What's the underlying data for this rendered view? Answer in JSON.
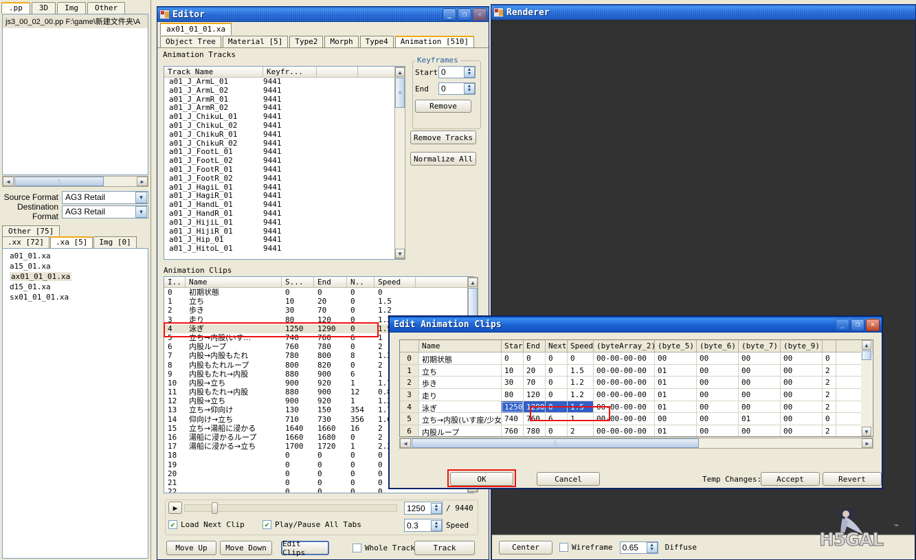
{
  "left_panel": {
    "tabs": [
      {
        "label": ".pp",
        "active": true
      },
      {
        "label": "3D",
        "active": false
      },
      {
        "label": "Img",
        "active": false
      },
      {
        "label": "Other",
        "active": false
      }
    ],
    "pp_entry": "js3_00_02_00.pp  F:\\game\\新建文件夹\\A",
    "source_format_label": "Source Format",
    "source_format_value": "AG3 Retail",
    "destination_format_label": "Destination Format",
    "destination_format_value": "AG3 Retail",
    "other_tab_label": "Other [75]",
    "sub_tabs": [
      {
        "label": ".xx [72]",
        "active": false
      },
      {
        "label": ".xa [5]",
        "active": true
      },
      {
        "label": "Img [0]",
        "active": false
      }
    ],
    "xa_files": [
      {
        "name": "a01_01.xa",
        "selected": false
      },
      {
        "name": "a15_01.xa",
        "selected": false
      },
      {
        "name": "ax01_01_01.xa",
        "selected": true
      },
      {
        "name": "d15_01.xa",
        "selected": false
      },
      {
        "name": "sx01_01_01.xa",
        "selected": false
      }
    ]
  },
  "editor": {
    "title": "Editor",
    "file_tab": "ax01_01_01.xa",
    "main_tabs": [
      {
        "label": "Object Tree",
        "active": false
      },
      {
        "label": "Material [5]",
        "active": false
      },
      {
        "label": "Type2",
        "active": false
      },
      {
        "label": "Morph",
        "active": false
      },
      {
        "label": "Type4",
        "active": false
      },
      {
        "label": "Animation [510]",
        "active": true
      }
    ],
    "tracks_section_label": "Animation Tracks",
    "tracks_headers": [
      "Track Name",
      "Keyfr..."
    ],
    "tracks": [
      {
        "name": "a01_J_ArmL_01",
        "keyframes": "9441"
      },
      {
        "name": "a01_J_ArmL_02",
        "keyframes": "9441"
      },
      {
        "name": "a01_J_ArmR_01",
        "keyframes": "9441"
      },
      {
        "name": "a01_J_ArmR_02",
        "keyframes": "9441"
      },
      {
        "name": "a01_J_ChikuL_01",
        "keyframes": "9441"
      },
      {
        "name": "a01_J_ChikuL_02",
        "keyframes": "9441"
      },
      {
        "name": "a01_J_ChikuR_01",
        "keyframes": "9441"
      },
      {
        "name": "a01_J_ChikuR_02",
        "keyframes": "9441"
      },
      {
        "name": "a01_J_FootL_01",
        "keyframes": "9441"
      },
      {
        "name": "a01_J_FootL_02",
        "keyframes": "9441"
      },
      {
        "name": "a01_J_FootR_01",
        "keyframes": "9441"
      },
      {
        "name": "a01_J_FootR_02",
        "keyframes": "9441"
      },
      {
        "name": "a01_J_HagiL_01",
        "keyframes": "9441"
      },
      {
        "name": "a01_J_HagiR_01",
        "keyframes": "9441"
      },
      {
        "name": "a01_J_HandL_01",
        "keyframes": "9441"
      },
      {
        "name": "a01_J_HandR_01",
        "keyframes": "9441"
      },
      {
        "name": "a01_J_HijiL_01",
        "keyframes": "9441"
      },
      {
        "name": "a01_J_HijiR_01",
        "keyframes": "9441"
      },
      {
        "name": "a01_J_Hip_01",
        "keyframes": "9441"
      },
      {
        "name": "a01_J_HitoL_01",
        "keyframes": "9441"
      }
    ],
    "keyframes_group": {
      "legend": "Keyframes",
      "start_label": "Start",
      "start_value": "0",
      "end_label": "End",
      "end_value": "0",
      "remove_label": "Remove"
    },
    "remove_tracks_label": "Remove Tracks",
    "normalize_all_label": "Normalize All",
    "clips_section_label": "Animation Clips",
    "clips_headers": [
      "I..",
      "Name",
      "S...",
      "End",
      "N..",
      "Speed"
    ],
    "clips": [
      {
        "i": "0",
        "name": "初期状態",
        "start": "0",
        "end": "0",
        "next": "0",
        "speed": "0"
      },
      {
        "i": "1",
        "name": "立ち",
        "start": "10",
        "end": "20",
        "next": "0",
        "speed": "1.5"
      },
      {
        "i": "2",
        "name": "歩き",
        "start": "30",
        "end": "70",
        "next": "0",
        "speed": "1.2"
      },
      {
        "i": "3",
        "name": "走り",
        "start": "80",
        "end": "120",
        "next": "0",
        "speed": "1.2"
      },
      {
        "i": "4",
        "name": "泳ぎ",
        "start": "1250",
        "end": "1290",
        "next": "0",
        "speed": "1.5"
      },
      {
        "i": "5",
        "name": "立ち→内股(いす...",
        "start": "740",
        "end": "760",
        "next": "6",
        "speed": "1"
      },
      {
        "i": "6",
        "name": "内股ループ",
        "start": "760",
        "end": "780",
        "next": "0",
        "speed": "2"
      },
      {
        "i": "7",
        "name": "内股→内股もたれ",
        "start": "780",
        "end": "800",
        "next": "8",
        "speed": "1.2"
      },
      {
        "i": "8",
        "name": "内股もたれループ",
        "start": "800",
        "end": "820",
        "next": "0",
        "speed": "2"
      },
      {
        "i": "9",
        "name": "内股もたれ→内股",
        "start": "880",
        "end": "900",
        "next": "6",
        "speed": "1"
      },
      {
        "i": "10",
        "name": "内股→立ち",
        "start": "900",
        "end": "920",
        "next": "1",
        "speed": "1.7"
      },
      {
        "i": "11",
        "name": "内股もたれ→内股",
        "start": "880",
        "end": "900",
        "next": "12",
        "speed": "0.8"
      },
      {
        "i": "12",
        "name": "内股→立ち",
        "start": "900",
        "end": "920",
        "next": "1",
        "speed": "1.2"
      },
      {
        "i": "13",
        "name": "立ち→仰向け",
        "start": "130",
        "end": "150",
        "next": "354",
        "speed": "1.7"
      },
      {
        "i": "14",
        "name": "仰向け→立ち",
        "start": "710",
        "end": "730",
        "next": "356",
        "speed": "1.6"
      },
      {
        "i": "15",
        "name": "立ち→湯船に浸かる",
        "start": "1640",
        "end": "1660",
        "next": "16",
        "speed": "2"
      },
      {
        "i": "16",
        "name": "湯船に浸かるループ",
        "start": "1660",
        "end": "1680",
        "next": "0",
        "speed": "2"
      },
      {
        "i": "17",
        "name": "湯船に浸かる→立ち",
        "start": "1700",
        "end": "1720",
        "next": "1",
        "speed": "2.2"
      },
      {
        "i": "18",
        "name": "",
        "start": "0",
        "end": "0",
        "next": "0",
        "speed": "0"
      },
      {
        "i": "19",
        "name": "",
        "start": "0",
        "end": "0",
        "next": "0",
        "speed": "0"
      },
      {
        "i": "20",
        "name": "",
        "start": "0",
        "end": "0",
        "next": "0",
        "speed": "0"
      },
      {
        "i": "21",
        "name": "",
        "start": "0",
        "end": "0",
        "next": "0",
        "speed": "0"
      },
      {
        "i": "22",
        "name": "",
        "start": "0",
        "end": "0",
        "next": "0",
        "speed": "0"
      }
    ],
    "selected_clip_index": 4,
    "transport": {
      "play_icon": "play-icon",
      "frame_value": "1250",
      "frame_total": "/ 9440",
      "speed_value": "0.3",
      "speed_label": "Speed",
      "load_next_clip_label": "Load Next Clip",
      "load_next_clip_checked": true,
      "play_pause_all_tabs_label": "Play/Pause All Tabs",
      "play_pause_all_tabs_checked": true
    },
    "buttons": {
      "move_up": "Move Up",
      "move_down": "Move Down",
      "edit_clips": "Edit Clips",
      "whole_track": "Whole Track",
      "whole_track_checked": false,
      "track": "Track"
    },
    "window_buttons": {
      "minimize": "minimize-icon",
      "maximize": "maximize-icon",
      "close": "close-icon"
    }
  },
  "renderer": {
    "title": "Renderer",
    "center_label": "Center",
    "wireframe_label": "Wireframe",
    "wireframe_checked": false,
    "diffuse_value": "0.65",
    "diffuse_label": "Diffuse",
    "watermark": "H5GAL",
    "watermark_tm": "TM"
  },
  "dialog": {
    "title": "Edit Animation Clips",
    "headers": [
      "",
      "Name",
      "Start",
      "End",
      "Next",
      "Speed",
      "(byteArray_2)",
      "(byte_5)",
      "(byte_6)",
      "(byte_7)",
      "(byte_9)",
      ""
    ],
    "rows": [
      {
        "idx": "0",
        "name": "初期状態",
        "start": "0",
        "end": "0",
        "next": "0",
        "speed": "0",
        "bytearray2": "00-00-00-00",
        "byte5": "00",
        "byte6": "00",
        "byte7": "00",
        "byte9": "00",
        "last": "0"
      },
      {
        "idx": "1",
        "name": "立ち",
        "start": "10",
        "end": "20",
        "next": "0",
        "speed": "1.5",
        "bytearray2": "00-00-00-00",
        "byte5": "01",
        "byte6": "00",
        "byte7": "00",
        "byte9": "00",
        "last": "2"
      },
      {
        "idx": "2",
        "name": "歩き",
        "start": "30",
        "end": "70",
        "next": "0",
        "speed": "1.2",
        "bytearray2": "00-00-00-00",
        "byte5": "01",
        "byte6": "00",
        "byte7": "00",
        "byte9": "00",
        "last": "2"
      },
      {
        "idx": "3",
        "name": "走り",
        "start": "80",
        "end": "120",
        "next": "0",
        "speed": "1.2",
        "bytearray2": "00-00-00-00",
        "byte5": "01",
        "byte6": "00",
        "byte7": "00",
        "byte9": "00",
        "last": "2"
      },
      {
        "idx": "4",
        "name": "泳ぎ",
        "start": "1250",
        "end": "1290",
        "next": "0",
        "speed": "1.5",
        "bytearray2": "00-00-00-00",
        "byte5": "01",
        "byte6": "00",
        "byte7": "00",
        "byte9": "00",
        "last": "2"
      },
      {
        "idx": "5",
        "name": "立ち→内股(いす座/少女)",
        "start": "740",
        "end": "760",
        "next": "6",
        "speed": "1",
        "bytearray2": "00-00-00-00",
        "byte5": "00",
        "byte6": "00",
        "byte7": "01",
        "byte9": "00",
        "last": "0"
      },
      {
        "idx": "6",
        "name": "内股ループ",
        "start": "760",
        "end": "780",
        "next": "0",
        "speed": "2",
        "bytearray2": "00-00-00-00",
        "byte5": "01",
        "byte6": "00",
        "byte7": "00",
        "byte9": "00",
        "last": "2"
      }
    ],
    "selected_row": 4,
    "buttons": {
      "ok": "OK",
      "cancel": "Cancel",
      "temp_changes_label": "Temp Changes:",
      "accept": "Accept",
      "revert": "Revert"
    },
    "window_buttons": {
      "minimize": "minimize-icon",
      "maximize": "maximize-icon",
      "close": "close-icon"
    }
  },
  "colors": {
    "titlebar_blue": "#1e63d4",
    "highlight_red": "#ee1111",
    "selection_blue": "#3060c8",
    "window_face": "#ece9d8"
  }
}
